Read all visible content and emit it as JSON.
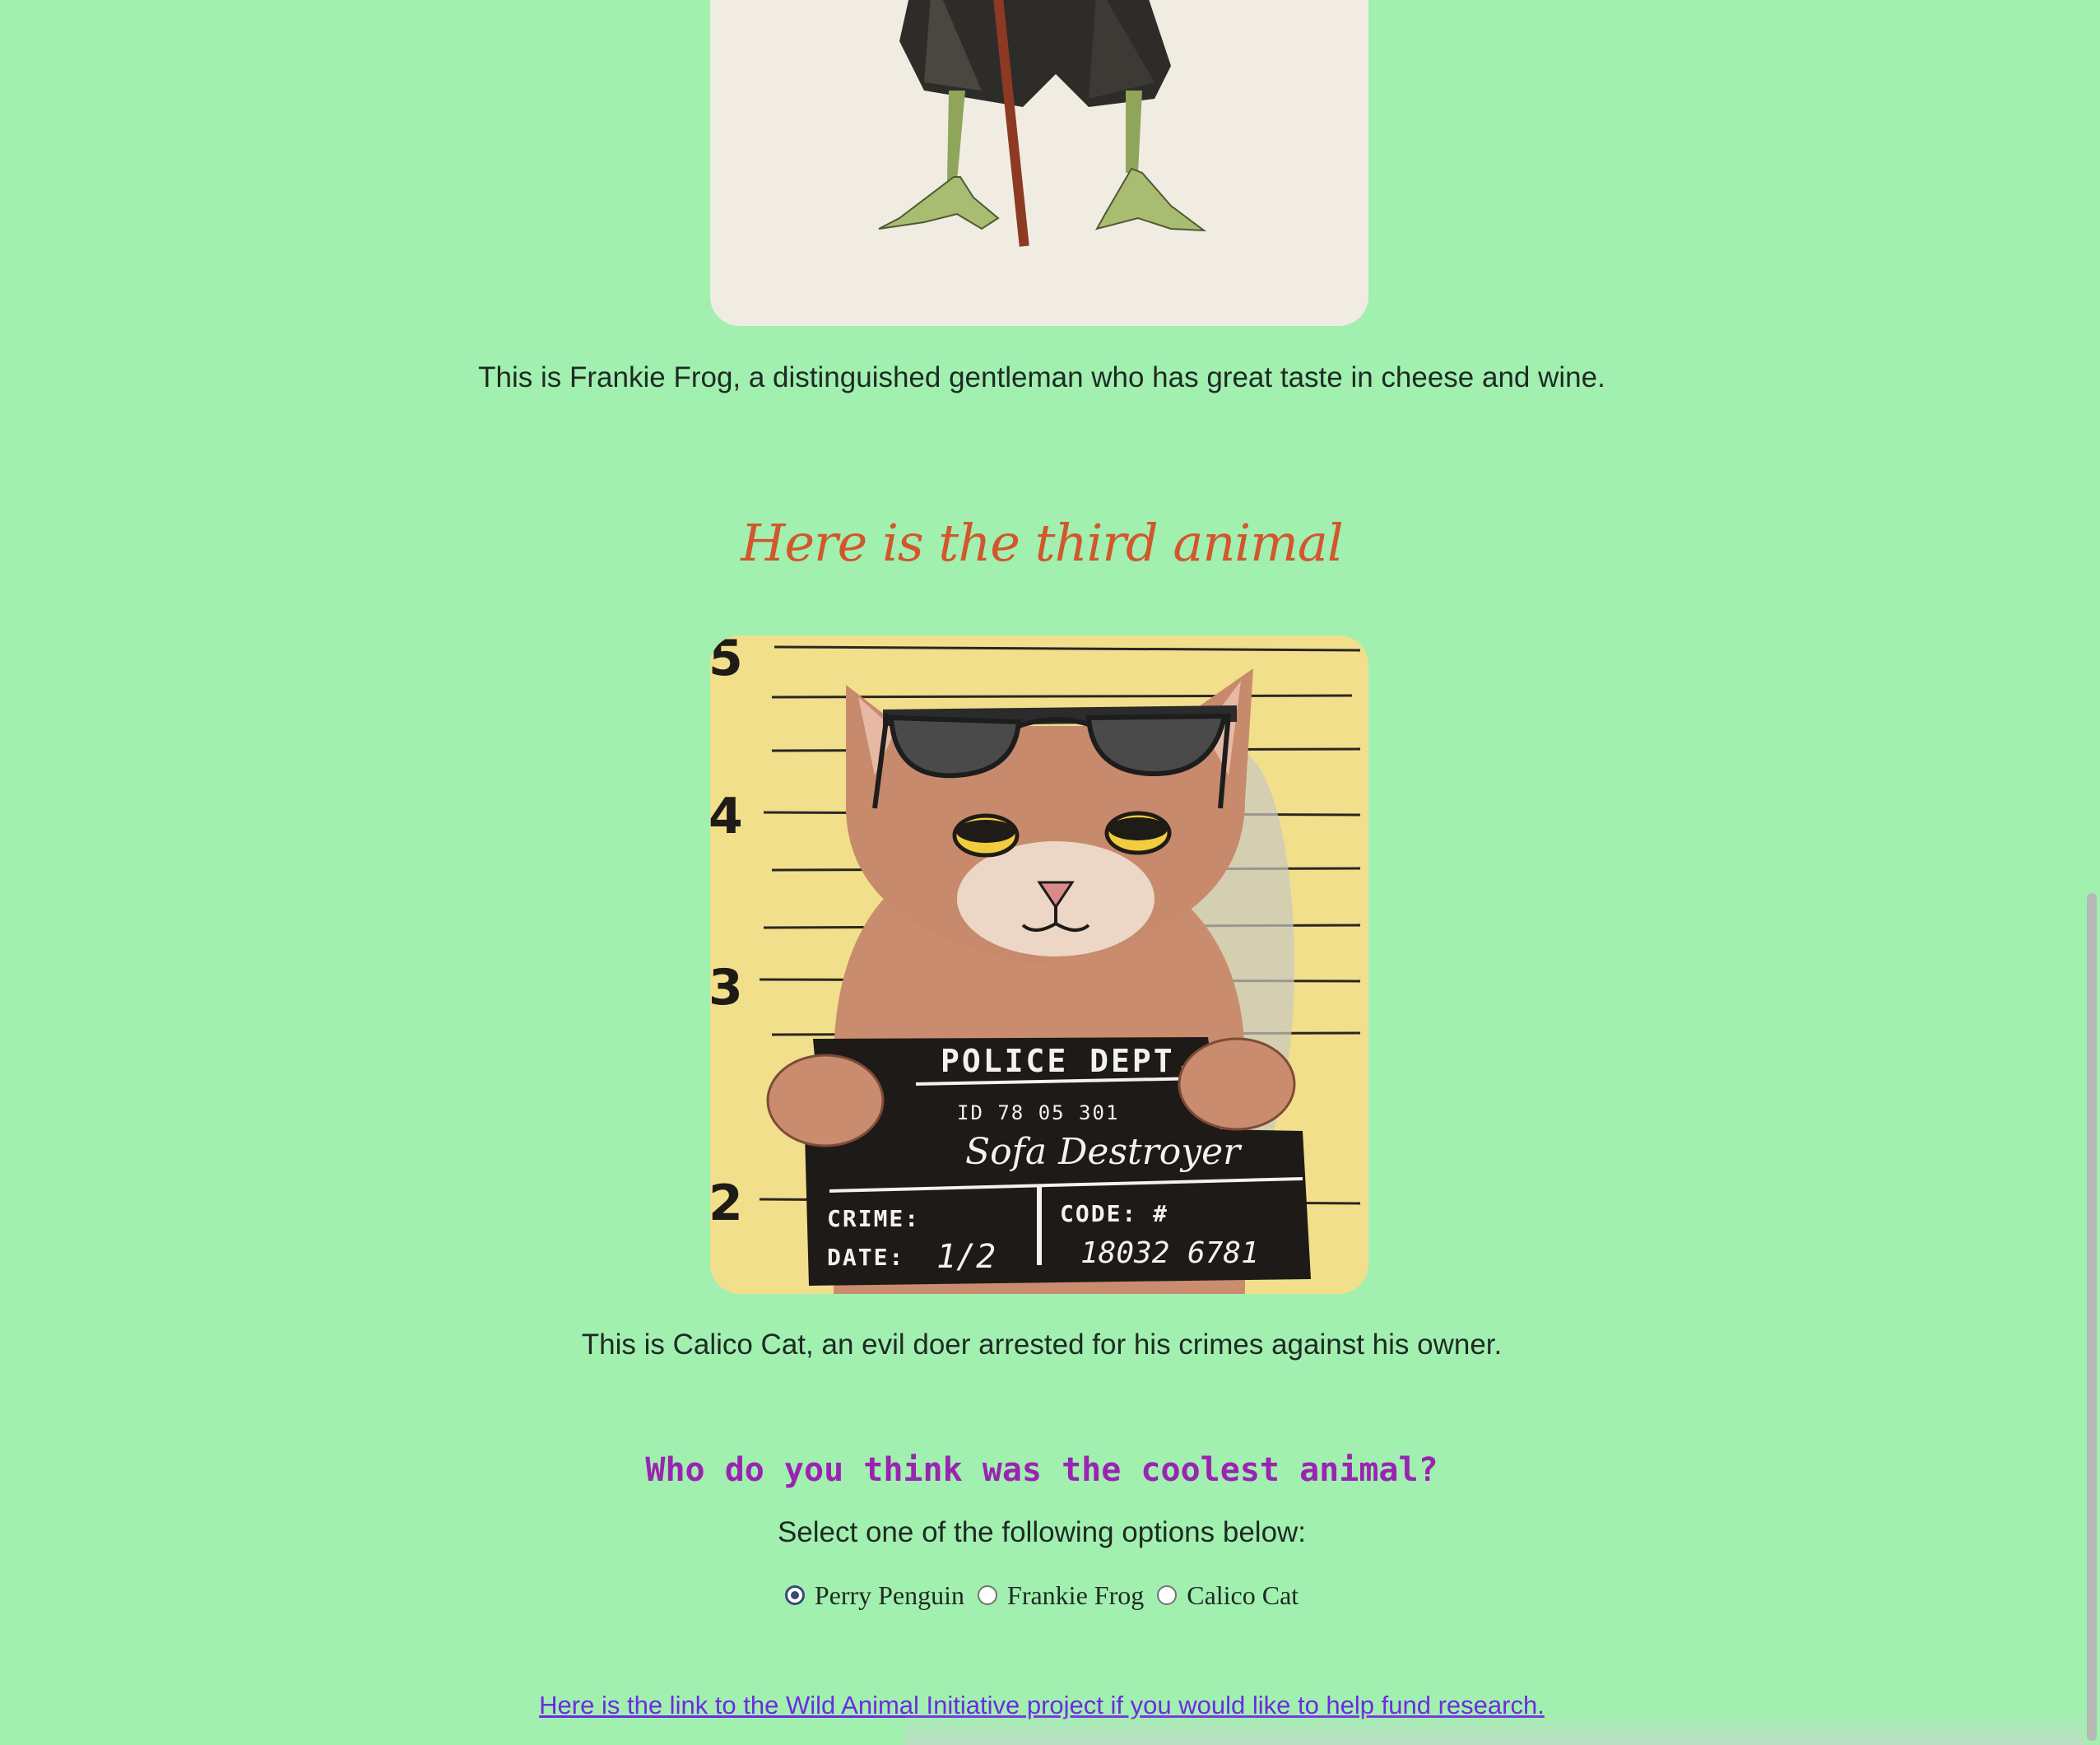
{
  "frog": {
    "caption": "This is Frankie Frog, a distinguished gentleman who has great taste in cheese and wine."
  },
  "third": {
    "heading": "Here is the third animal"
  },
  "cat": {
    "caption": "This is Calico Cat, an evil doer arrested for his crimes against his owner.",
    "mugshot": {
      "height_marks": [
        "5",
        "4",
        "3",
        "2"
      ],
      "board_title": "POLICE DEPT.",
      "id_line": "ID 78   05   301",
      "name": "Sofa Destroyer",
      "crime_label": "CRIME:",
      "date_label": "DATE:",
      "date_value": "1/2",
      "code_label": "CODE: #",
      "code_value": "18032 6781"
    }
  },
  "poll": {
    "question": "Who do you think was the coolest animal?",
    "instruction": "Select one of the following options below:",
    "options": [
      {
        "label": "Perry Penguin",
        "selected": true
      },
      {
        "label": "Frankie Frog",
        "selected": false
      },
      {
        "label": "Calico Cat",
        "selected": false
      }
    ]
  },
  "footer": {
    "link_text": "Here is the link to the Wild Animal Initiative project if you would like to help fund research."
  },
  "colors": {
    "background": "#a1f0b0",
    "heading": "#d3572c",
    "question": "#9b23b2",
    "link": "#6d2be0"
  }
}
